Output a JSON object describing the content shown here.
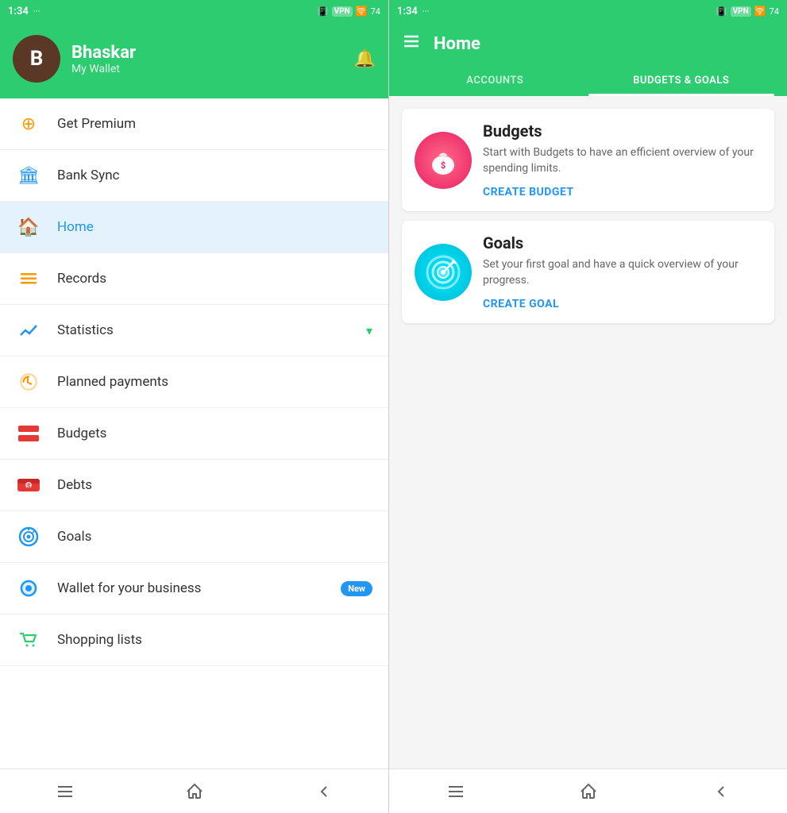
{
  "left": {
    "statusBar": {
      "time": "1:34",
      "dots": "···",
      "icons": "📳 VPN 🛜 74"
    },
    "header": {
      "avatarLetter": "B",
      "userName": "Bhaskar",
      "userSub": "My Wallet"
    },
    "menuItems": [
      {
        "id": "get-premium",
        "label": "Get Premium",
        "icon": "⊕",
        "iconColor": "#ff9800",
        "active": false
      },
      {
        "id": "bank-sync",
        "label": "Bank Sync",
        "icon": "🏛",
        "iconColor": "#2196f3",
        "active": false
      },
      {
        "id": "home",
        "label": "Home",
        "icon": "🏠",
        "iconColor": "#2196f3",
        "active": true
      },
      {
        "id": "records",
        "label": "Records",
        "icon": "≡",
        "iconColor": "#ff9800",
        "active": false
      },
      {
        "id": "statistics",
        "label": "Statistics",
        "icon": "📈",
        "iconColor": "#2196f3",
        "active": false,
        "hasChevron": true
      },
      {
        "id": "planned-payments",
        "label": "Planned payments",
        "icon": "🔄",
        "iconColor": "#ff9800",
        "active": false
      },
      {
        "id": "budgets",
        "label": "Budgets",
        "icon": "▬",
        "iconColor": "#e53935",
        "active": false
      },
      {
        "id": "debts",
        "label": "Debts",
        "icon": "💳",
        "iconColor": "#e53935",
        "active": false
      },
      {
        "id": "goals",
        "label": "Goals",
        "icon": "🎯",
        "iconColor": "#2196f3",
        "active": false
      },
      {
        "id": "wallet-business",
        "label": "Wallet for your business",
        "icon": "🔵",
        "iconColor": "#2196f3",
        "active": false,
        "badge": "New"
      },
      {
        "id": "shopping-lists",
        "label": "Shopping lists",
        "icon": "🛒",
        "iconColor": "#2ecc71",
        "active": false
      }
    ],
    "bottomNav": [
      {
        "id": "menu",
        "icon": "☰"
      },
      {
        "id": "home",
        "icon": "⌂"
      },
      {
        "id": "back",
        "icon": "↩"
      }
    ]
  },
  "right": {
    "statusBar": {
      "time": "1:34",
      "dots": "···",
      "icons": "📳 VPN 🛜 74"
    },
    "header": {
      "title": "Home",
      "hamburgerIcon": "☰"
    },
    "tabs": [
      {
        "id": "accounts",
        "label": "ACCOUNTS",
        "active": false
      },
      {
        "id": "budgets-goals",
        "label": "BUDGETS & GOALS",
        "active": true
      }
    ],
    "cards": [
      {
        "id": "budgets-card",
        "title": "Budgets",
        "description": "Start with Budgets to have an efficient overview of your spending limits.",
        "actionLabel": "CREATE BUDGET",
        "iconType": "budgets"
      },
      {
        "id": "goals-card",
        "title": "Goals",
        "description": "Set your first goal and have a quick overview of your progress.",
        "actionLabel": "CREATE GOAL",
        "iconType": "goals"
      }
    ],
    "bottomNav": [
      {
        "id": "menu",
        "icon": "☰"
      },
      {
        "id": "home",
        "icon": "⌂"
      },
      {
        "id": "back",
        "icon": "↩"
      }
    ]
  }
}
